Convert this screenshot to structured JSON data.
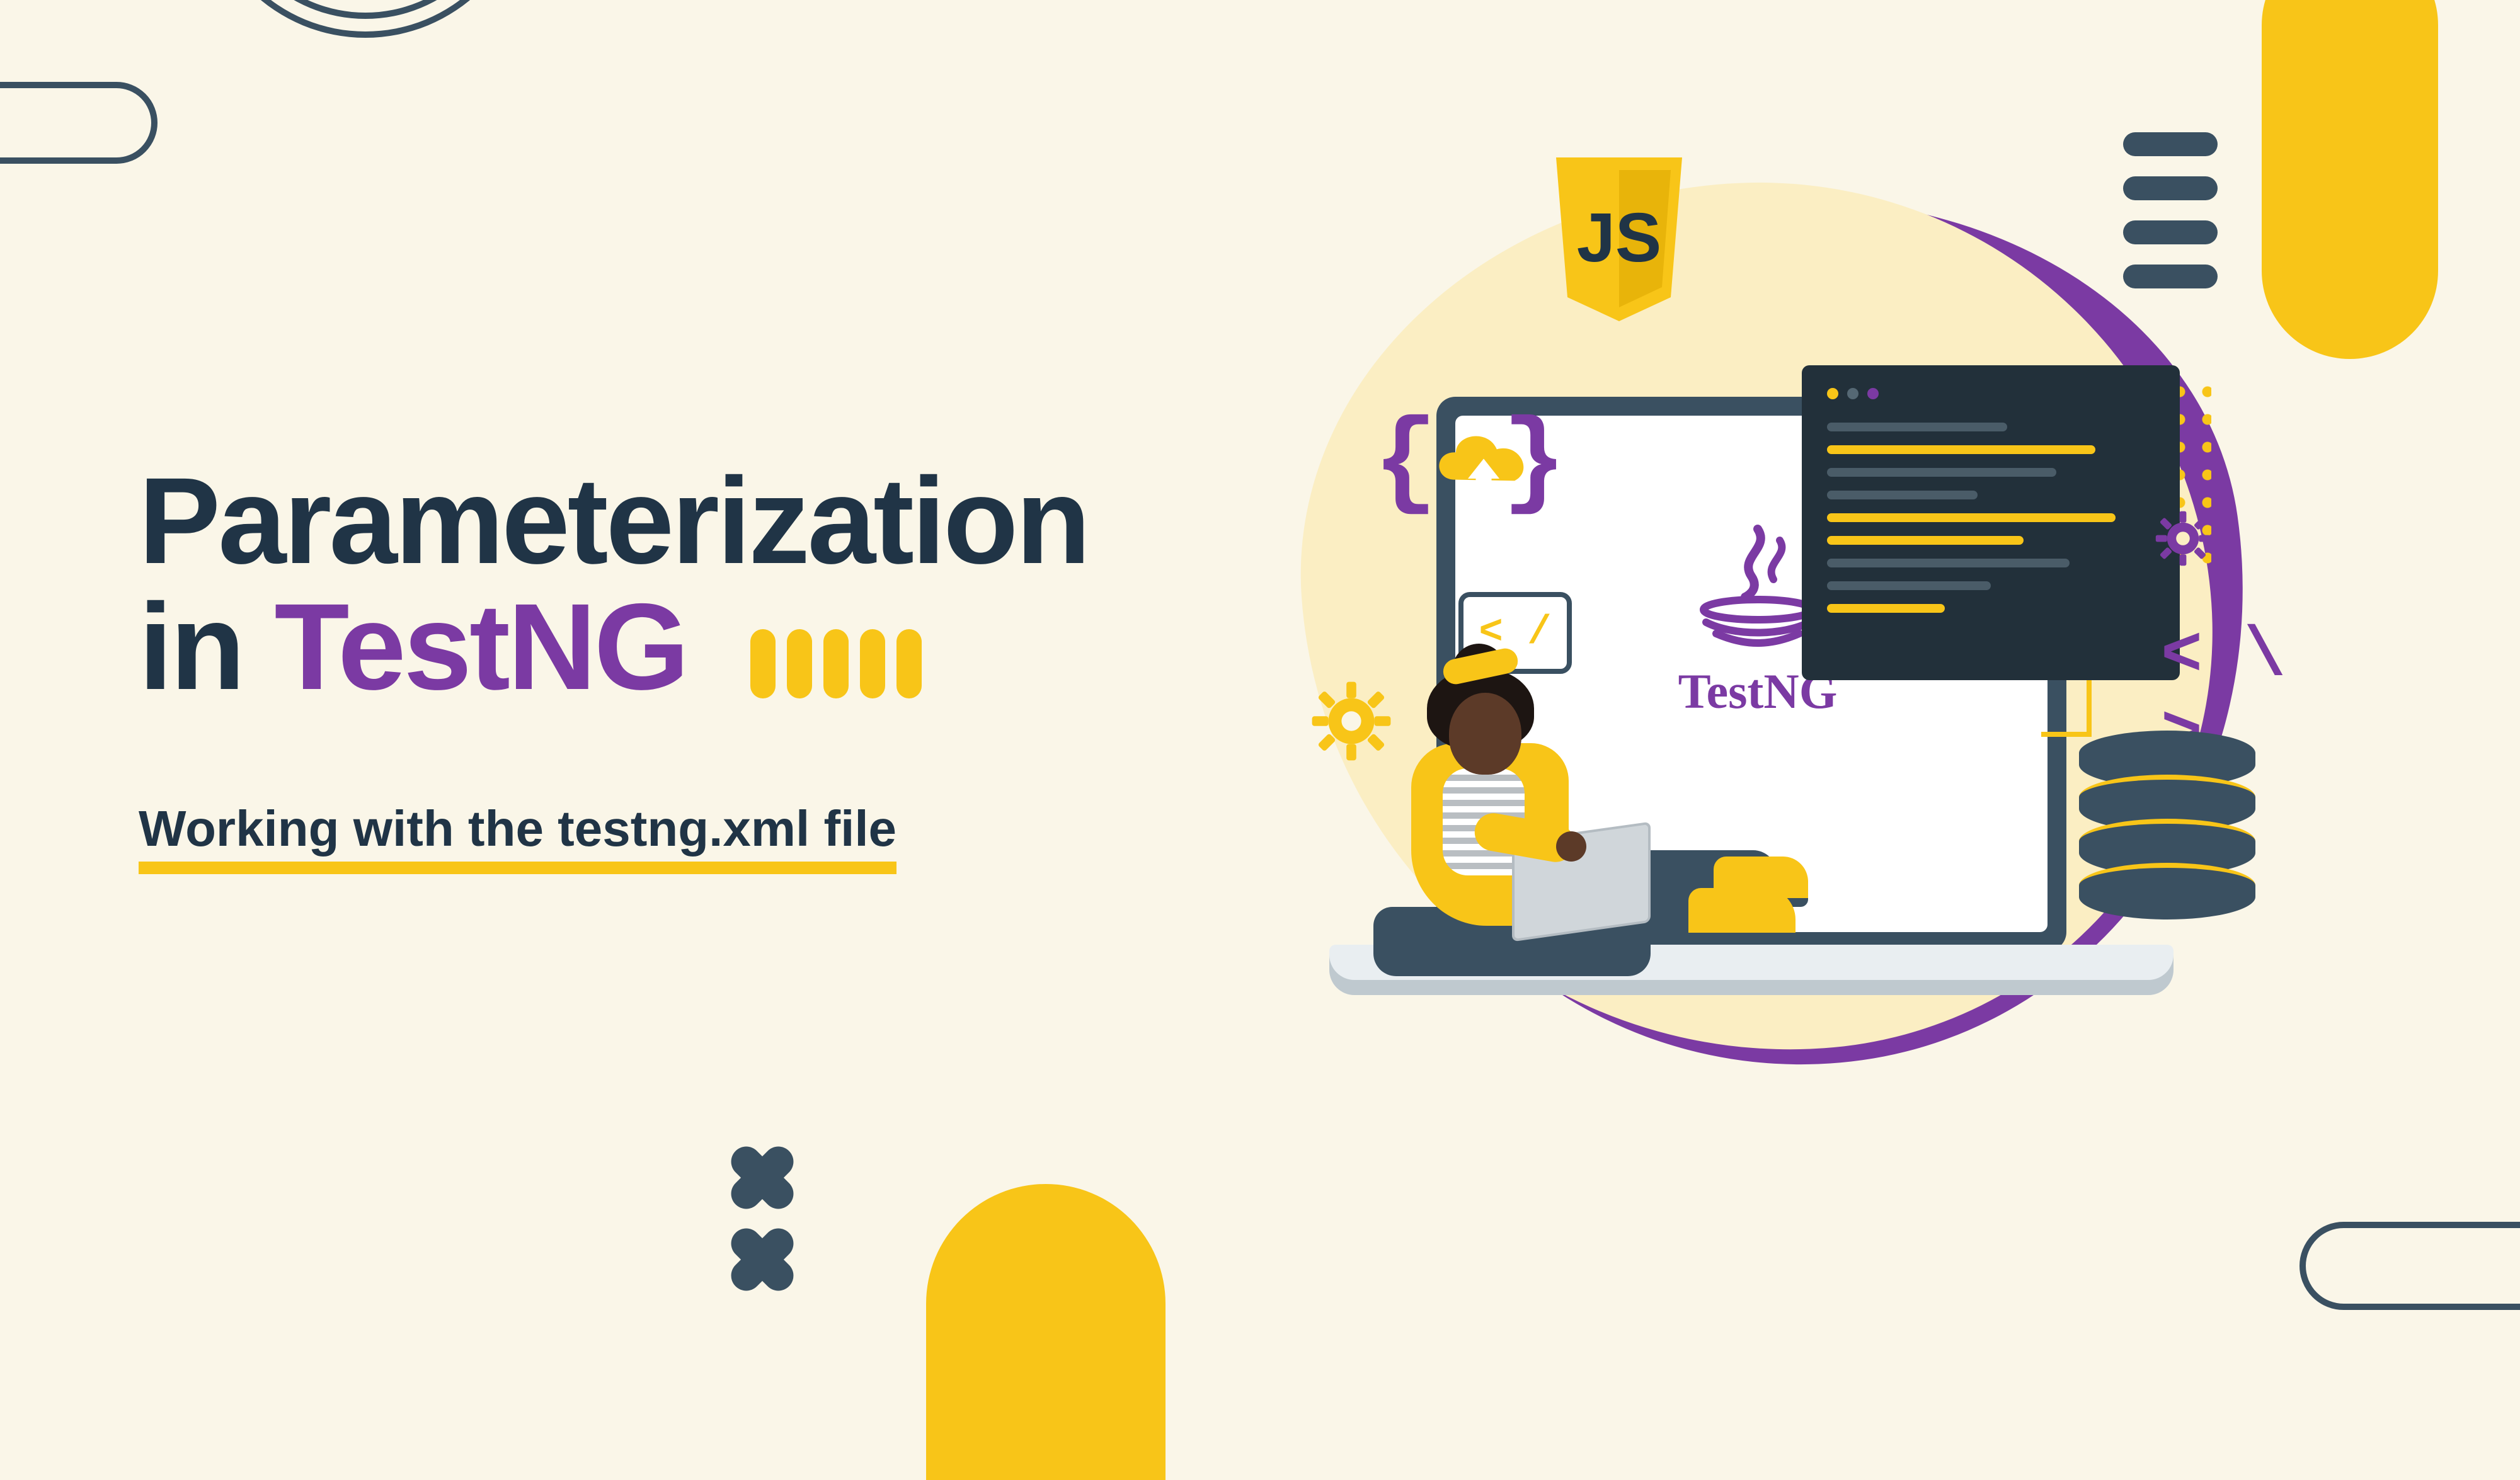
{
  "title": {
    "line1": "Parameterization",
    "line2_plain": "in ",
    "line2_highlight": "TestNG"
  },
  "subtitle": "Working with the testng.xml file",
  "illustration": {
    "js_badge_text": "JS",
    "testng_label": "TestNG",
    "bubble_code": "< / >",
    "code_angle": "< \\ >"
  },
  "colors": {
    "bg": "#faf6e8",
    "navy": "#203446",
    "slate": "#3a5061",
    "purple": "#7b3aa3",
    "yellow": "#f8c518"
  }
}
